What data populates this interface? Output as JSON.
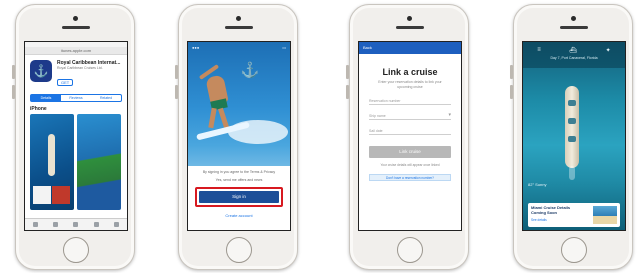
{
  "screens": {
    "app_store": {
      "url": "itunes.apple.com",
      "app_name": "Royal Caribbean Internat...",
      "app_subtitle": "Royal Caribbean Cruises Ltd.",
      "get_label": "GET",
      "tabs": [
        "Details",
        "Reviews",
        "Related"
      ],
      "section_title": "iPhone"
    },
    "sign_in": {
      "terms_text": "By signing in you agree to the Terms & Privacy",
      "terms_link": "Terms",
      "check_text": "Yes, send me offers and news",
      "sign_in_label": "Sign in",
      "create_account_label": "Create account"
    },
    "link_cruise": {
      "header": "Back",
      "title": "Link a cruise",
      "subtitle": "Enter your reservation details to link your upcoming cruise",
      "field_reservation": "Reservation number",
      "field_ship": "Ship name",
      "field_date": "Sail date",
      "button_label": "Link cruise",
      "note": "Your cruise details will appear once linked",
      "help_label": "Don't have a reservation number?"
    },
    "ship_tracker": {
      "location": "Day 7, Port Canaveral, Florida",
      "weather": "82° Sunny",
      "card_title": "Miami Cruise Details Coming Soon",
      "card_link": "See details"
    }
  }
}
